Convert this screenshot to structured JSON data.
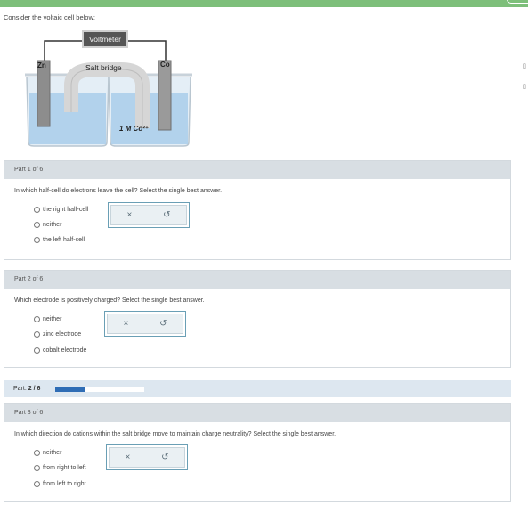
{
  "intro": "Consider the voltaic cell below:",
  "diagram": {
    "voltmeter": "Voltmeter",
    "left_electrode": "Zn",
    "right_electrode": "Co",
    "salt_bridge": "Salt bridge",
    "concentration": "1 M Co²⁺"
  },
  "parts": [
    {
      "header": "Part 1 of 6",
      "question": "In which half-cell do electrons leave the cell? Select the single best answer.",
      "options": [
        "the right half-cell",
        "neither",
        "the left half-cell"
      ]
    },
    {
      "header": "Part 2 of 6",
      "question": "Which electrode is positively charged? Select the single best answer.",
      "options": [
        "neither",
        "zinc electrode",
        "cobalt electrode"
      ]
    },
    {
      "header": "Part 3 of 6",
      "question": "In which direction do cations within the salt bridge move to maintain charge neutrality? Select the single best answer.",
      "options": [
        "neither",
        "from right to left",
        "from left to right"
      ]
    }
  ],
  "progress": {
    "label": "Part:",
    "value": "2 / 6",
    "fraction": 0.33
  },
  "icons": {
    "clear": "×",
    "undo": "↺"
  }
}
